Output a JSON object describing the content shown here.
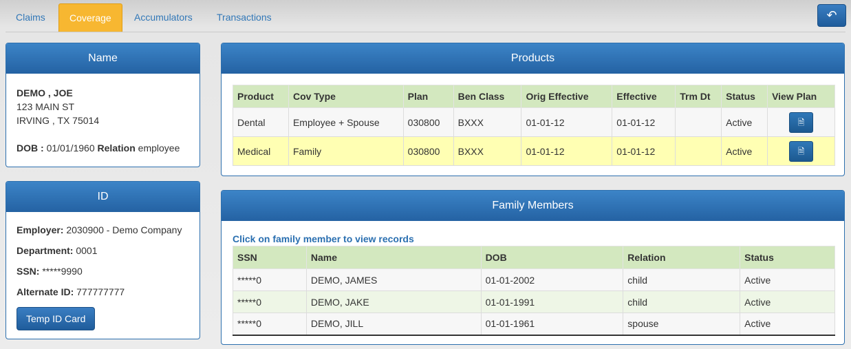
{
  "tabs": [
    {
      "label": "Claims"
    },
    {
      "label": "Coverage",
      "active": true
    },
    {
      "label": "Accumulators"
    },
    {
      "label": "Transactions"
    }
  ],
  "back_button": {
    "icon": "undo-arrow-icon"
  },
  "name_panel": {
    "title": "Name",
    "member_name": "DEMO , JOE",
    "address_line1": "123 MAIN ST",
    "address_line2": "IRVING , TX 75014",
    "dob_label": "DOB :",
    "dob_value": "01/01/1960",
    "relation_label": "Relation",
    "relation_value": "employee"
  },
  "id_panel": {
    "title": "ID",
    "employer_label": "Employer:",
    "employer_value": "2030900 - Demo Company",
    "department_label": "Department:",
    "department_value": "0001",
    "ssn_label": "SSN:",
    "ssn_value": "*****9990",
    "alternate_label": "Alternate ID:",
    "alternate_value": "777777777",
    "temp_card_button": "Temp ID Card"
  },
  "products": {
    "title": "Products",
    "columns": [
      "Product",
      "Cov Type",
      "Plan",
      "Ben Class",
      "Orig Effective",
      "Effective",
      "Trm Dt",
      "Status",
      "View Plan"
    ],
    "rows": [
      {
        "product": "Dental",
        "cov_type": "Employee + Spouse",
        "plan": "030800",
        "ben_class": "BXXX",
        "orig_effective": "01-01-12",
        "effective": "01-01-12",
        "trm_dt": "",
        "status": "Active"
      },
      {
        "product": "Medical",
        "cov_type": "Family",
        "plan": "030800",
        "ben_class": "BXXX",
        "orig_effective": "01-01-12",
        "effective": "01-01-12",
        "trm_dt": "",
        "status": "Active"
      }
    ],
    "highlight_color": "#ffffb3",
    "header_color": "#d3e8bf"
  },
  "family": {
    "title": "Family Members",
    "hint": "Click on family member to view records",
    "columns": [
      "SSN",
      "Name",
      "DOB",
      "Relation",
      "Status"
    ],
    "rows": [
      {
        "ssn": "*****0",
        "name": "DEMO, JAMES",
        "dob": "01-01-2002",
        "relation": "child",
        "status": "Active"
      },
      {
        "ssn": "*****0",
        "name": "DEMO, JAKE",
        "dob": "01-01-1991",
        "relation": "child",
        "status": "Active"
      },
      {
        "ssn": "*****0",
        "name": "DEMO, JILL",
        "dob": "01-01-1961",
        "relation": "spouse",
        "status": "Active"
      }
    ]
  }
}
